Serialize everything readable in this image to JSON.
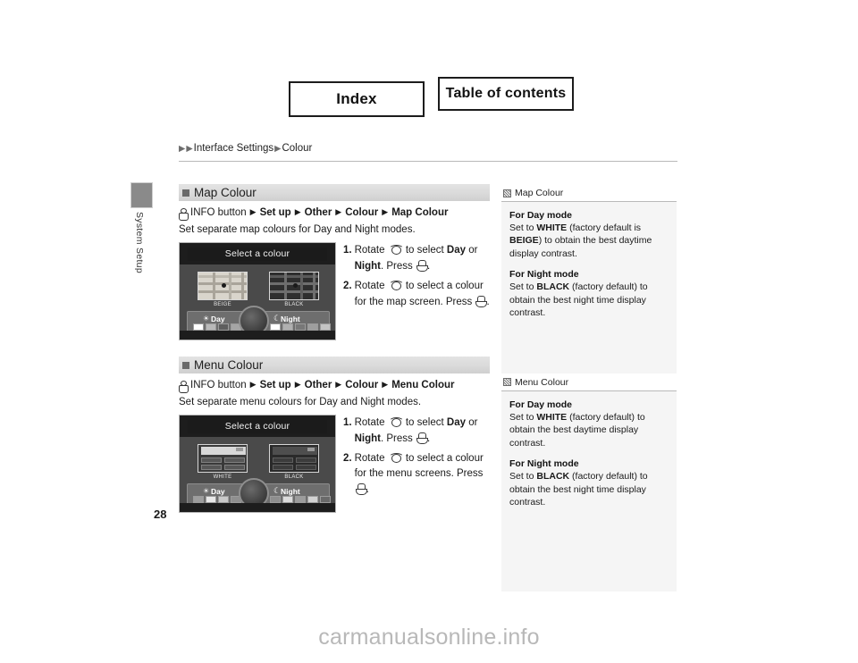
{
  "nav": {
    "index_label": "Index",
    "toc_label": "Table of contents"
  },
  "breadcrumb": {
    "part1": "Interface Settings",
    "part2": "Colour"
  },
  "sidebar": {
    "chapter_label": "System Setup",
    "page_number": "28"
  },
  "sections": [
    {
      "title": "Map Colour",
      "path": {
        "source": "INFO button",
        "steps": [
          "Set up",
          "Other",
          "Colour",
          "Map Colour"
        ]
      },
      "description": "Set separate map colours for Day and Night modes.",
      "instructions": [
        {
          "num": "1.",
          "pre": "Rotate ",
          "mid": " to select ",
          "opt1": "Day",
          "or": " or ",
          "opt2": "Night",
          "tail": ". Press ",
          "end": "."
        },
        {
          "num": "2.",
          "pre": "Rotate ",
          "mid": " to select a colour for the map screen. Press ",
          "end": "."
        }
      ],
      "screenshot": {
        "title": "Select a colour",
        "left_caption": "BEIGE",
        "right_caption": "BLACK",
        "day_label": "Day",
        "night_label": "Night"
      }
    },
    {
      "title": "Menu Colour",
      "path": {
        "source": "INFO button",
        "steps": [
          "Set up",
          "Other",
          "Colour",
          "Menu Colour"
        ]
      },
      "description": "Set separate menu colours for Day and Night modes.",
      "instructions": [
        {
          "num": "1.",
          "pre": "Rotate ",
          "mid": " to select ",
          "opt1": "Day",
          "or": " or ",
          "opt2": "Night",
          "tail": ". Press ",
          "end": "."
        },
        {
          "num": "2.",
          "pre": "Rotate ",
          "mid": " to select a colour for the menu screens. Press ",
          "end": "."
        }
      ],
      "screenshot": {
        "title": "Select a colour",
        "left_caption": "WHITE",
        "right_caption": "BLACK",
        "day_label": "Day",
        "night_label": "Night"
      }
    }
  ],
  "notes": [
    {
      "header": "Map Colour",
      "entries": [
        {
          "subtitle": "For Day mode",
          "t1": "Set to ",
          "b1": "WHITE",
          "t2": " (factory default is ",
          "b2": "BEIGE",
          "t3": ") to obtain the best daytime display contrast."
        },
        {
          "subtitle": "For Night mode",
          "t1": "Set to ",
          "b1": "BLACK",
          "t2": " (factory default) to obtain the best night time display contrast.",
          "b2": "",
          "t3": ""
        }
      ]
    },
    {
      "header": "Menu Colour",
      "entries": [
        {
          "subtitle": "For Day mode",
          "t1": "Set to ",
          "b1": "WHITE",
          "t2": " (factory default) to obtain the best daytime display contrast.",
          "b2": "",
          "t3": ""
        },
        {
          "subtitle": "For Night mode",
          "t1": "Set to ",
          "b1": "BLACK",
          "t2": " (factory default) to obtain the best night time display contrast.",
          "b2": "",
          "t3": ""
        }
      ]
    }
  ],
  "watermark": "carmanualsonline.info"
}
